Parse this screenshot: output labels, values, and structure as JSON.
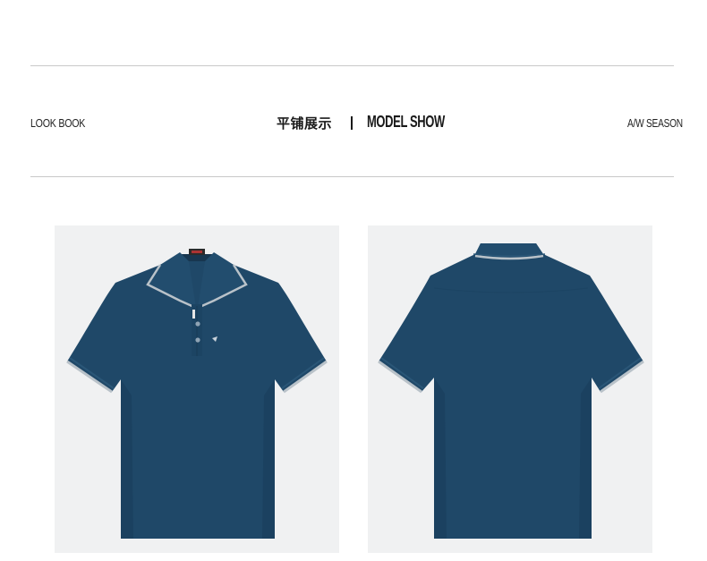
{
  "header": {
    "left_label": "LOOK BOOK",
    "title_cn": "平铺展示",
    "separator": "|",
    "title_en": "MODEL SHOW",
    "right_label": "A/W SEASON"
  },
  "colors": {
    "shirt": "#1f4868",
    "shirt_shadow": "#1a3f5d",
    "trim": "#b9c2c9",
    "panel_bg": "#f0f1f2",
    "rule": "#c9c9c9",
    "text": "#1a1a1a"
  },
  "gallery": {
    "items": [
      {
        "view": "front",
        "icon": "polo-shirt-front-image"
      },
      {
        "view": "back",
        "icon": "polo-shirt-back-image"
      }
    ]
  }
}
